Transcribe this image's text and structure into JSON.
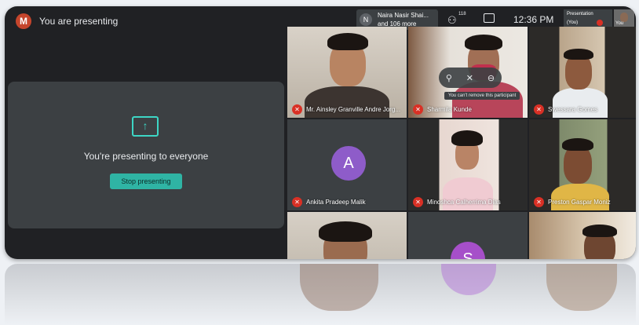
{
  "window": {
    "initial": "M",
    "title": "You are presenting"
  },
  "presenting": {
    "message": "You're presenting to everyone",
    "stop_label": "Stop presenting"
  },
  "header": {
    "caption_initial": "N",
    "caption_name": "Naira Nasir Shai...",
    "caption_more": "and 106 more",
    "participants_count": "118",
    "clock": "12:36 PM",
    "self_tile_line1": "Presentation",
    "self_tile_line2": "(You)",
    "self_label": "You"
  },
  "participant_controls": {
    "tooltip": "You can't remove this participant"
  },
  "participants": [
    {
      "name": "Mr. Ainsley Granville Andre Jorg...",
      "muted": true
    },
    {
      "name": "Sharmila Kunde",
      "muted": true
    },
    {
      "name": "Swessara Gomes",
      "muted": true
    },
    {
      "name": "Ankita Pradeep Malik",
      "initial": "A",
      "avatar_color": "#8e5cc9",
      "muted": true
    },
    {
      "name": "Minoshca Calherrima Dias",
      "muted": true
    },
    {
      "name": "Preston Gaspar Moniz",
      "muted": true
    },
    {
      "name": "",
      "muted": false
    },
    {
      "name": "",
      "initial": "S",
      "avatar_color": "#a64fc9",
      "muted": false
    },
    {
      "name": "",
      "muted": false
    }
  ],
  "colors": {
    "accent": "#2fb4a4",
    "mute_red": "#d93025",
    "background": "#202124"
  }
}
